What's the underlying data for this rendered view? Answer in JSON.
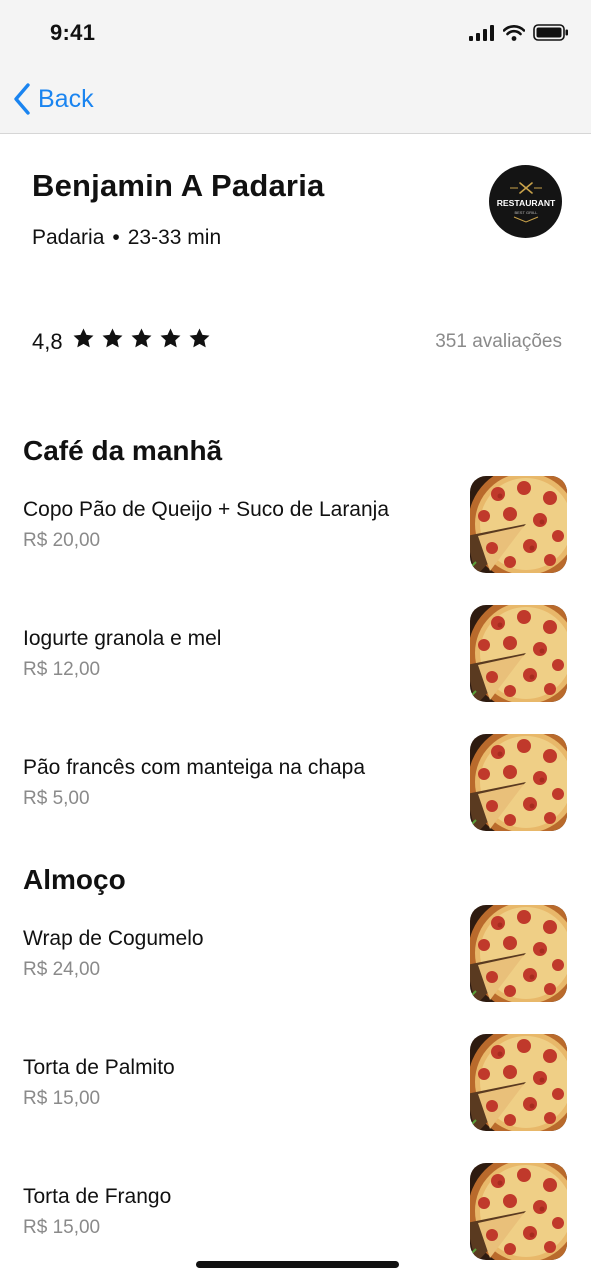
{
  "status_bar": {
    "time": "9:41"
  },
  "nav": {
    "back_label": "Back"
  },
  "store": {
    "name": "Benjamin A Padaria",
    "category": "Padaria",
    "separator": "•",
    "delivery_time": "23-33 min",
    "logo_text": "RESTAURANT",
    "logo_subtext": "BEST GRILL"
  },
  "rating": {
    "value": "4,8",
    "stars": 5,
    "reviews": "351 avaliações"
  },
  "sections": [
    {
      "title": "Café da manhã",
      "items": [
        {
          "name": "Copo Pão de Queijo + Suco de Laranja",
          "price": "R$ 20,00"
        },
        {
          "name": "Iogurte granola e mel",
          "price": "R$ 12,00"
        },
        {
          "name": "Pão francês com manteiga na chapa",
          "price": "R$ 5,00"
        }
      ]
    },
    {
      "title": "Almoço",
      "items": [
        {
          "name": "Wrap de Cogumelo",
          "price": "R$ 24,00"
        },
        {
          "name": "Torta de Palmito",
          "price": "R$ 15,00"
        },
        {
          "name": "Torta de Frango",
          "price": "R$ 15,00"
        }
      ]
    }
  ],
  "colors": {
    "accent": "#1a84f0",
    "muted": "#8a8a8a",
    "bar_bg": "#f4f4f4"
  }
}
